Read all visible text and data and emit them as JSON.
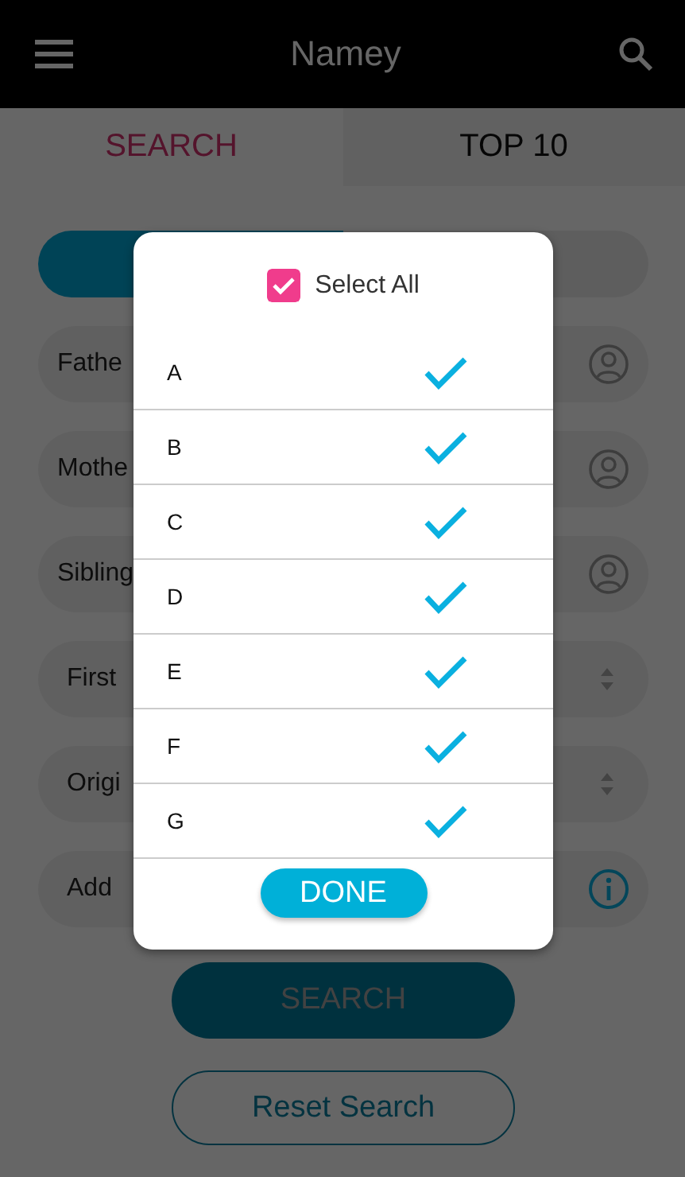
{
  "app_bar": {
    "title": "Namey"
  },
  "tabs": [
    {
      "label": "SEARCH",
      "selected": true
    },
    {
      "label": "TOP 10",
      "selected": false
    }
  ],
  "toggle": [
    {
      "selected": true
    },
    {
      "selected": false
    }
  ],
  "fields": [
    {
      "label": "Fathe",
      "kind": "person"
    },
    {
      "label": "Mothe",
      "kind": "person"
    },
    {
      "label": "Sibling",
      "kind": "person"
    },
    {
      "label": "First",
      "kind": "spinner"
    },
    {
      "label": "Origi",
      "kind": "spinner"
    },
    {
      "label": "Add",
      "kind": "info"
    }
  ],
  "search_button": "SEARCH",
  "reset_button": "Reset Search",
  "dialog": {
    "select_all": {
      "label": "Select All",
      "checked": true
    },
    "options": [
      {
        "label": "A",
        "checked": true
      },
      {
        "label": "B",
        "checked": true
      },
      {
        "label": "C",
        "checked": true
      },
      {
        "label": "D",
        "checked": true
      },
      {
        "label": "E",
        "checked": true
      },
      {
        "label": "F",
        "checked": true
      },
      {
        "label": "G",
        "checked": true
      }
    ],
    "done_button": "DONE"
  }
}
